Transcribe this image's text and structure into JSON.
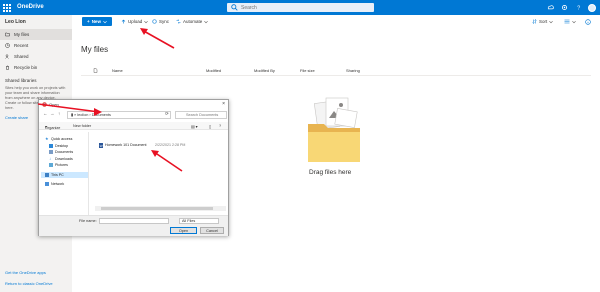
{
  "topbar": {
    "app_title": "OneDrive",
    "search_placeholder": "Search",
    "icons": [
      "app-launcher-icon",
      "search-icon",
      "sync-status-icon",
      "settings-icon",
      "help-icon",
      "avatar"
    ]
  },
  "sidebar": {
    "user_name": "Leo Lion",
    "items": [
      {
        "label": "My files",
        "icon": "folder-icon",
        "active": true
      },
      {
        "label": "Recent",
        "icon": "clock-icon",
        "active": false
      },
      {
        "label": "Shared",
        "icon": "people-icon",
        "active": false
      },
      {
        "label": "Recycle bin",
        "icon": "trash-icon",
        "active": false
      }
    ],
    "shared_libraries_title": "Shared libraries",
    "shared_libraries_text": "Sites help you work on projects with your team and share information from anywhere on any device. Create or follow sites to see them here.",
    "create_link": "Create share",
    "footer_links": [
      "Get the OneDrive apps",
      "Return to classic OneDrive"
    ]
  },
  "commandbar": {
    "new_label": "New",
    "upload_label": "Upload",
    "sync_label": "Sync",
    "automate_label": "Automate",
    "sort_label": "Sort"
  },
  "main": {
    "title": "My files",
    "columns": [
      "Name",
      "Modified",
      "Modified By",
      "File size",
      "Sharing"
    ],
    "empty_text": "Drag files here"
  },
  "dialog": {
    "title": "Open",
    "path_parts": [
      "leolion",
      "Documents"
    ],
    "search_placeholder": "Search Documents",
    "organize_label": "Organize",
    "new_folder_label": "New folder",
    "tree": [
      {
        "label": "Quick access",
        "icon": "star-icon",
        "indent": false
      },
      {
        "label": "Desktop",
        "icon": "desktop-icon",
        "indent": true
      },
      {
        "label": "Documents",
        "icon": "documents-icon",
        "indent": true
      },
      {
        "label": "Downloads",
        "icon": "download-icon",
        "indent": true
      },
      {
        "label": "Pictures",
        "icon": "pictures-icon",
        "indent": true
      },
      {
        "label": "This PC",
        "icon": "pc-icon",
        "indent": false,
        "selected": true
      },
      {
        "label": "Network",
        "icon": "network-icon",
        "indent": false
      }
    ],
    "file": {
      "name": "Homework 101 Document",
      "date": "2/22/2021 2:28 PM"
    },
    "file_name_label": "File name:",
    "file_name_value": "",
    "file_type_value": "All Files",
    "open_label": "Open",
    "cancel_label": "Cancel"
  },
  "colors": {
    "brand": "#0078d4",
    "sidebar_bg": "#f3f2f1",
    "annotation_arrow": "#e81123"
  }
}
